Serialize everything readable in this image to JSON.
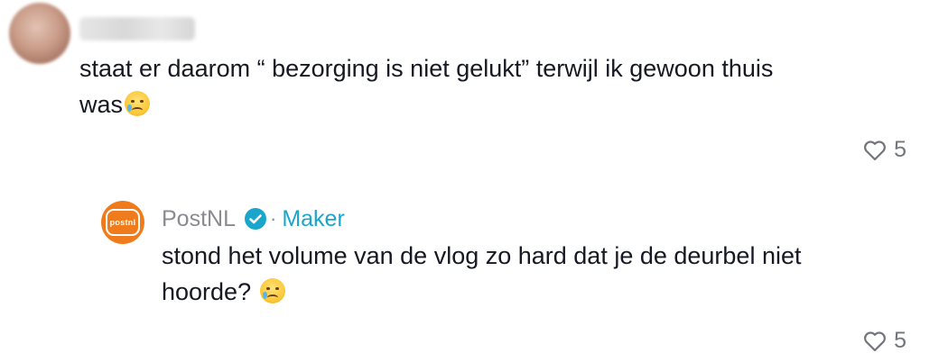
{
  "comment": {
    "text": "staat er daarom “ bezorging is niet gelukt” terwijl ik gewoon thuis was",
    "emoji": "crying-smile-emoji",
    "likes": "5"
  },
  "reply": {
    "author": "PostNL",
    "badge": "Maker",
    "separator": "·",
    "avatar_text": "postnl",
    "text": "stond het volume van de vlog zo hard dat je de deurbel niet hoorde?",
    "emoji": "crying-smile-emoji",
    "likes": "5"
  },
  "colors": {
    "brand_orange": "#f07b1d",
    "verified_blue": "#1aa6cc",
    "muted_gray": "#8a8b91",
    "text_dark": "#161823"
  }
}
